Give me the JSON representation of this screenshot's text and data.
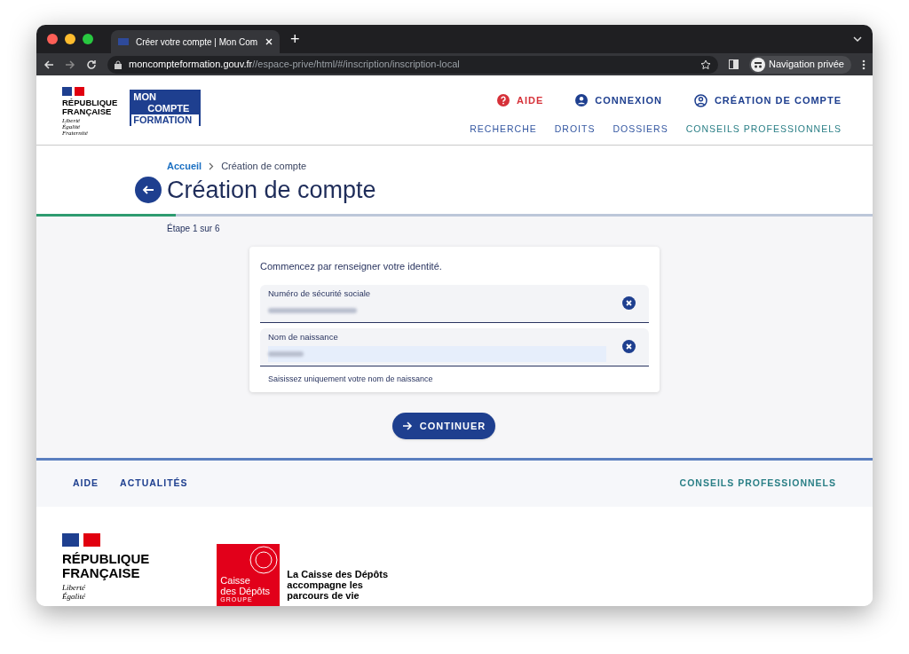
{
  "browser": {
    "tab_title": "Créer votre compte | Mon Com",
    "url_host": "moncompteformation.gouv.fr",
    "url_path": "//espace-prive/html/#/inscription/inscription-local",
    "new_tab": "+",
    "profile": "Navigation privée"
  },
  "header": {
    "republique": [
      "RÉPUBLIQUE",
      "FRANÇAISE"
    ],
    "motto": [
      "Liberté",
      "Égalité",
      "Fraternité"
    ],
    "brand": [
      "MON",
      "COMPTE",
      "FORMATION"
    ],
    "top_links": [
      {
        "label": "AIDE",
        "kind": "help"
      },
      {
        "label": "CONNEXION",
        "kind": "user"
      },
      {
        "label": "CRÉATION DE COMPTE",
        "kind": "account"
      }
    ],
    "nav": [
      {
        "label": "RECHERCHE",
        "color": "#3558a2"
      },
      {
        "label": "DROITS",
        "color": "#3558a2"
      },
      {
        "label": "DOSSIERS",
        "color": "#3558a2"
      },
      {
        "label": "CONSEILS PROFESSIONNELS",
        "color": "#2a7f86"
      }
    ]
  },
  "breadcrumb": [
    {
      "label": "Accueil",
      "kind": "link"
    },
    {
      "label": "Création de compte",
      "kind": "current"
    }
  ],
  "title": "Création de compte",
  "progress": {
    "level": 0.167,
    "label": "Étape 1 sur 6"
  },
  "form": {
    "intro": "Commencez par renseigner votre identité.",
    "fields": [
      {
        "label": "Numéro de sécurité sociale",
        "highlighted": false
      },
      {
        "label": "Nom de naissance",
        "highlighted": true
      }
    ],
    "hint": "Saisissez uniquement votre nom de naissance",
    "button": "CONTINUER"
  },
  "footer": {
    "links": [
      {
        "label": "AIDE",
        "color": "#1e3f8f"
      },
      {
        "label": "ACTUALITÉS",
        "color": "#1e3f8f"
      },
      {
        "label": "CONSEILS PROFESSIONNELS",
        "color": "#2a7f86"
      }
    ],
    "republique": [
      "RÉPUBLIQUE",
      "FRANÇAISE"
    ],
    "motto": [
      "Liberté",
      "Égalité"
    ],
    "cdc": [
      "Caisse",
      "des Dépôts",
      "GROUPE"
    ],
    "tagline": "La Caisse des Dépôts\naccompagne les\nparcours de vie"
  }
}
